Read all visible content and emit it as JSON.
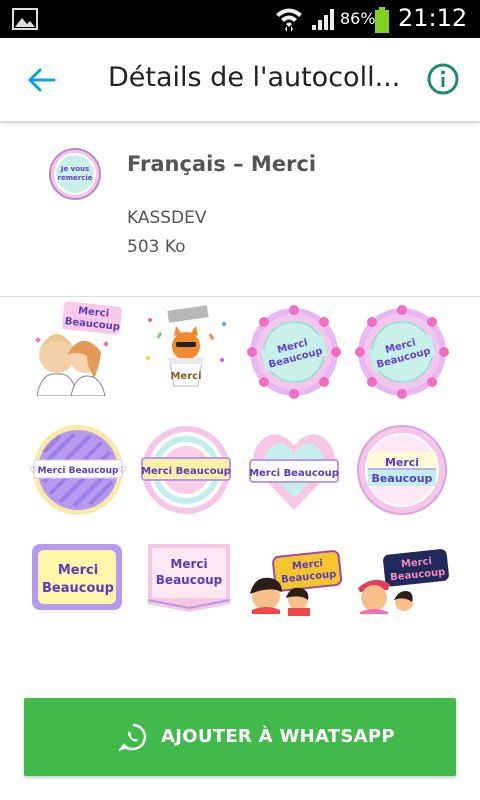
{
  "status_bar": {
    "battery_percent": "86%",
    "time": "21:12",
    "icons": [
      "gallery-icon",
      "wifi-icon",
      "signal-icon",
      "battery-icon"
    ]
  },
  "app_bar": {
    "title": "Détails de l'autocoll...",
    "back_icon": "arrow-left-icon",
    "info_icon": "info-circle-icon",
    "accent_color": "#0aa5d6",
    "info_color": "#1f8a70"
  },
  "pack": {
    "tray_text": "Je vous remercie",
    "name": "Français – Merci",
    "publisher": "KASSDEV",
    "size": "503 Ko"
  },
  "stickers": [
    {
      "id": 1,
      "text": "Merci Beaucoup"
    },
    {
      "id": 2,
      "text": "Merci"
    },
    {
      "id": 3,
      "text": "Merci Beaucoup"
    },
    {
      "id": 4,
      "text": "Merci Beaucoup"
    },
    {
      "id": 5,
      "text": "Merci Beaucoup"
    },
    {
      "id": 6,
      "text": "Merci Beaucoup"
    },
    {
      "id": 7,
      "text": "Merci Beaucoup"
    },
    {
      "id": 8,
      "text": "Merci Beaucoup"
    },
    {
      "id": 9,
      "text": "Merci Beaucoup"
    },
    {
      "id": 10,
      "text": "Merci Beaucoup"
    },
    {
      "id": 11,
      "text": "Merci Beaucoup"
    },
    {
      "id": 12,
      "text": "Merci Beaucoup"
    }
  ],
  "add_button": {
    "label": "AJOUTER À WHATSAPP",
    "icon": "whatsapp-icon",
    "color": "#42b94b"
  }
}
